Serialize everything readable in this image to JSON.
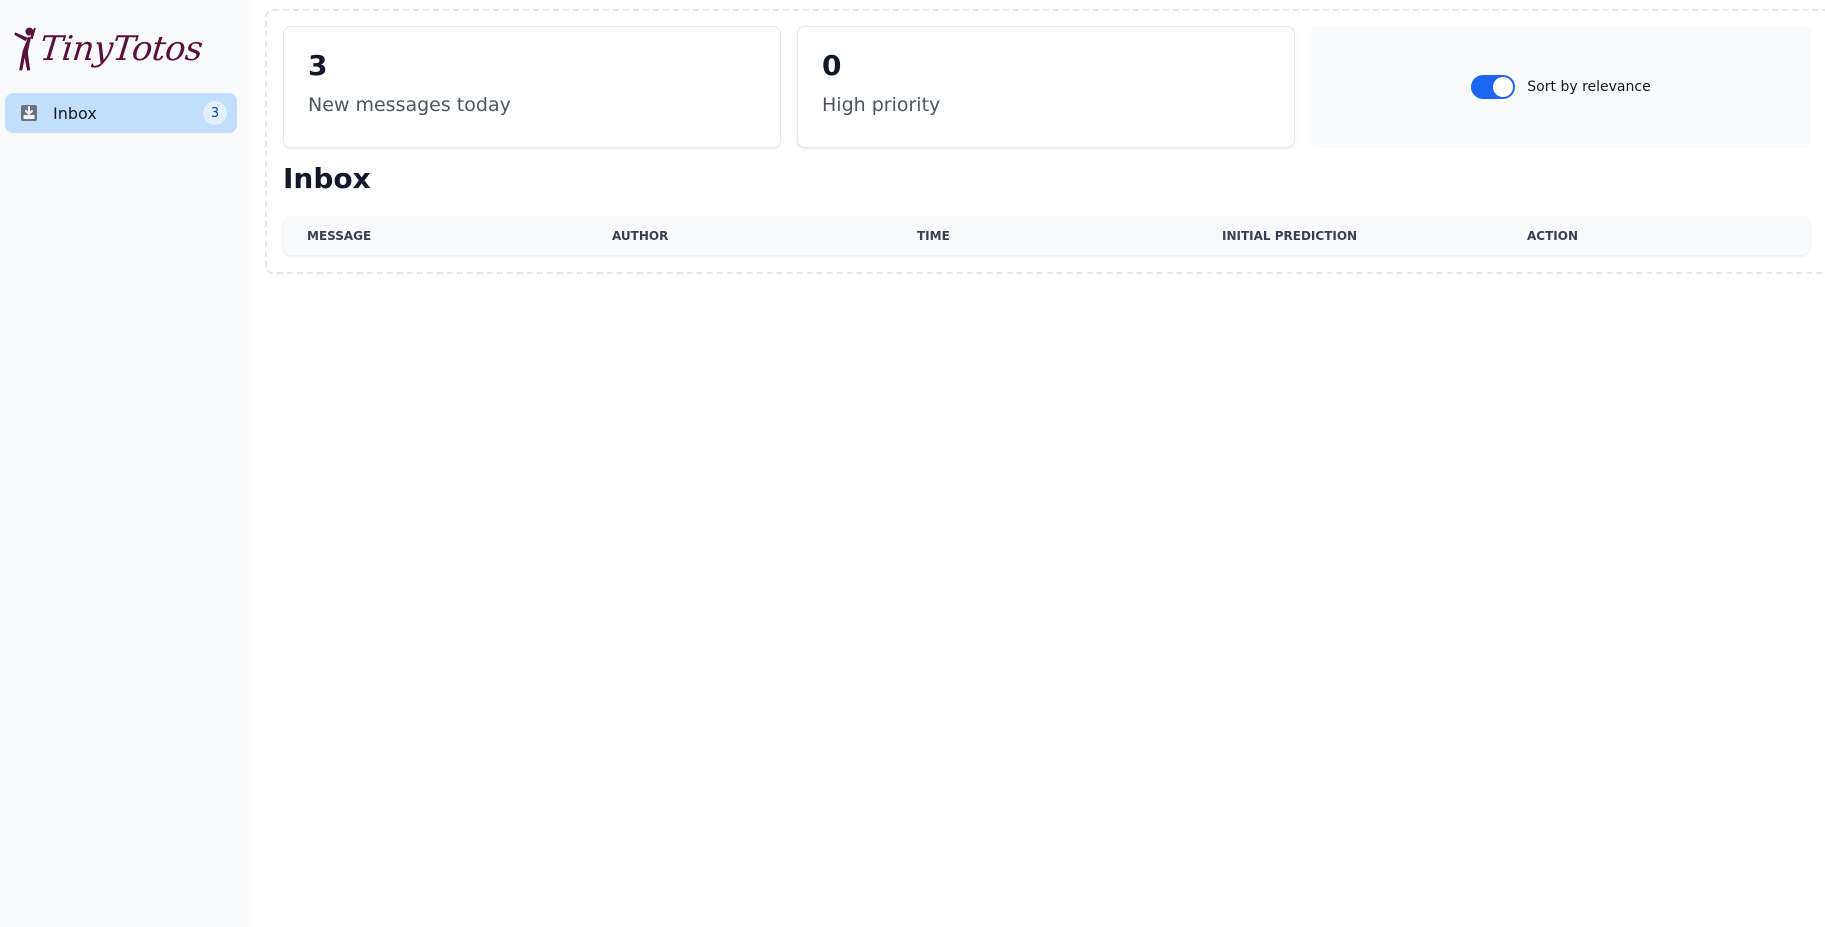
{
  "sidebar": {
    "logo_text": "TinyTotos",
    "logo_icon": "dancing-figure-icon",
    "items": [
      {
        "label": "Inbox",
        "icon": "inbox-download-icon",
        "badge": "3"
      }
    ]
  },
  "stats": [
    {
      "value": "3",
      "label": "New messages today"
    },
    {
      "value": "0",
      "label": "High priority"
    }
  ],
  "sort_toggle": {
    "label": "Sort by relevance",
    "on": true
  },
  "inbox": {
    "title": "Inbox",
    "columns": [
      "Message",
      "Author",
      "Time",
      "Initial prediction",
      "Action"
    ]
  },
  "colors": {
    "brand": "#5b0f3a",
    "accent": "#1c64f2",
    "nav_active": "#c3ddfd"
  }
}
